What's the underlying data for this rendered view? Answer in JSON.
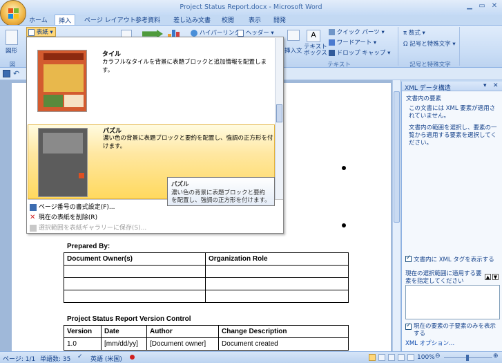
{
  "window": {
    "title": "Project Status Report.docx - Microsoft Word"
  },
  "tabs": [
    "ホーム",
    "挿入",
    "ページ レイアウト",
    "参考資料",
    "差し込み文書",
    "校閲",
    "表示",
    "開発"
  ],
  "ribbon": {
    "table_label": "表紙",
    "hyperlink_label": "ハイパーリンク",
    "header_label": "ヘッダー",
    "quick_parts": "クイック パーツ",
    "wordart": "ワードアート",
    "dropcap": "ドロップ キャップ",
    "textbox_label": "テキスト\nボックス",
    "text_group": "テキスト",
    "equation": "数式",
    "symbol": "記号と特殊文字",
    "symbols_group": "記号と特殊文字",
    "insert_text_fragment": "挿入文",
    "zu": "図形",
    "zu_group": "図"
  },
  "dropdown": {
    "item1": {
      "title": "タイル",
      "desc": "カラフルなタイルを背景に表題ブロックと追加情報を配置します。"
    },
    "item2": {
      "title": "パズル",
      "desc": "濃い色の背景に表題ブロックと要約を配置し、強調の正方形を付けます。"
    },
    "tooltip_title": "パズル",
    "tooltip_desc": "濃い色の背景に表題ブロックと要約を配置し、強調の正方形を付けます。",
    "menu": [
      "ページ番号の書式設定(F)...",
      "現在の表紙を削除(R)",
      "選択範囲を表紙ギャラリーに保存(S)..."
    ]
  },
  "document": {
    "prepared_by": "Prepared By:",
    "table1_headers": [
      "Document Owner(s)",
      "Organization Role"
    ],
    "version_title": "Project Status Report Version Control",
    "table2_headers": [
      "Version",
      "Date",
      "Author",
      "Change Description"
    ],
    "table2_partial": [
      "1.0",
      "[mm/dd/yy]",
      "[Document owner]",
      "Document created"
    ]
  },
  "xml_pane": {
    "title": "XML データ構造",
    "elements_label": "文書内の要素",
    "no_xml": "この文書には XML 要素が適用されていません。",
    "instruction": "文書内の範囲を選択し、要素の一覧から適用する要素を選択してください。",
    "show_tags": "文書内に XML タグを表示する",
    "selection_label": "現在の選択範囲に適用する要素を指定してください",
    "child_only": "現在の要素の子要素のみを表示する",
    "options_link": "XML オプション..."
  },
  "status": {
    "page": "ページ: 1/1",
    "words": "単語数: 35",
    "language": "英語 (米国)",
    "zoom": "100%"
  }
}
